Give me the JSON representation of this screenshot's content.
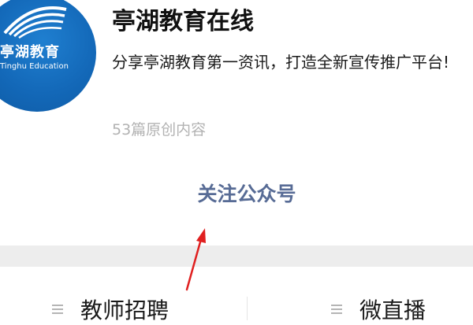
{
  "profile": {
    "avatar": {
      "logo_text_cn": "亭湖教育",
      "logo_text_en": "Tinghu Education",
      "brand_color": "#1368b8"
    },
    "account_name": "亭湖教育在线",
    "description": "分享亭湖教育第一资讯，打造全新宣传推广平台!",
    "article_count": "53篇原创内容",
    "follow_button_label": "关注公众号",
    "follow_button_color": "#576b95"
  },
  "annotation": {
    "arrow_color": "#e02020"
  },
  "bottom_menu": {
    "items": [
      {
        "label": "教师招聘",
        "icon": "menu-list-icon"
      },
      {
        "label": "微直播",
        "icon": "menu-list-icon"
      }
    ]
  }
}
